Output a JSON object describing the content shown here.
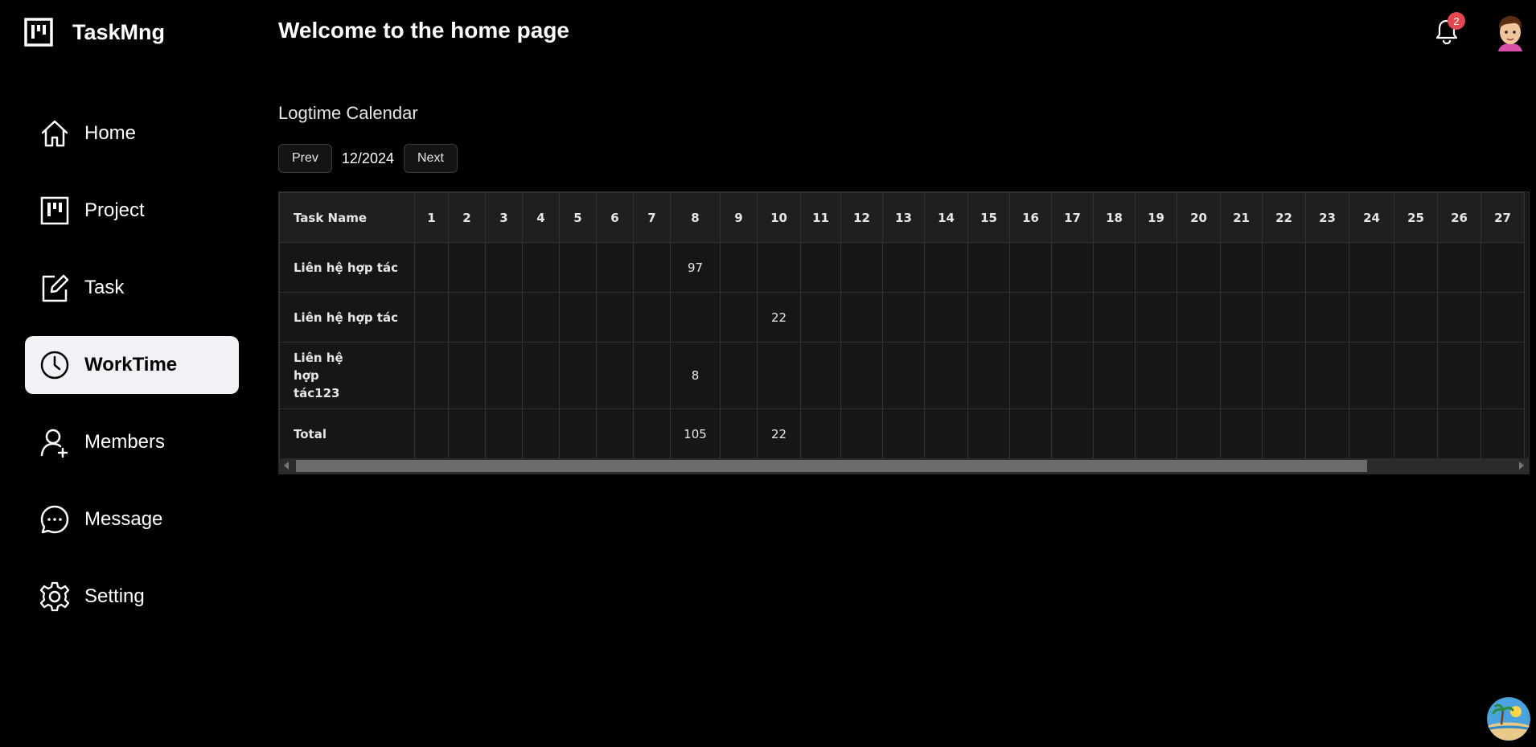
{
  "app": {
    "name": "TaskMng"
  },
  "header": {
    "title": "Welcome to the home page",
    "notification_count": "2"
  },
  "sidebar": {
    "items": [
      {
        "label": "Home",
        "icon": "home-icon"
      },
      {
        "label": "Project",
        "icon": "project-icon"
      },
      {
        "label": "Task",
        "icon": "edit-icon"
      },
      {
        "label": "WorkTime",
        "icon": "clock-icon",
        "active": true
      },
      {
        "label": "Members",
        "icon": "user-add-icon"
      },
      {
        "label": "Message",
        "icon": "message-icon"
      },
      {
        "label": "Setting",
        "icon": "gear-icon"
      }
    ]
  },
  "calendar": {
    "title": "Logtime Calendar",
    "prev_label": "Prev",
    "next_label": "Next",
    "month": "12/2024",
    "task_header": "Task Name",
    "days": [
      "1",
      "2",
      "3",
      "4",
      "5",
      "6",
      "7",
      "8",
      "9",
      "10",
      "11",
      "12",
      "13",
      "14",
      "15",
      "16",
      "17",
      "18",
      "19",
      "20",
      "21",
      "22",
      "23",
      "24",
      "25",
      "26",
      "27"
    ],
    "rows": [
      {
        "name": "Liên hệ hợp tác",
        "values": {
          "8": "97"
        }
      },
      {
        "name": "Liên hệ hợp tác",
        "values": {
          "10": "22"
        }
      },
      {
        "name": "Liên hệ hợp tác123",
        "values": {
          "8": "8"
        }
      },
      {
        "name": "Total",
        "values": {
          "8": "105",
          "10": "22"
        }
      }
    ]
  },
  "colors": {
    "accent_active_bg": "#f1f1f6",
    "badge": "#e34850",
    "background": "#000000"
  }
}
